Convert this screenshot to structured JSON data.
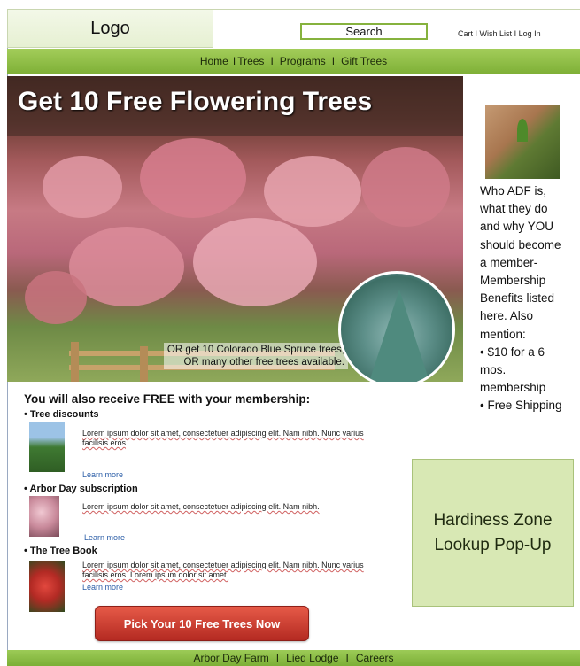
{
  "header": {
    "logo": "Logo",
    "search_label": "Search",
    "top_links": [
      "Cart",
      "Wish List",
      "Log In"
    ]
  },
  "nav": {
    "items": [
      "Home",
      "Trees",
      "Programs",
      "Gift Trees"
    ]
  },
  "hero": {
    "title": "Get 10 Free Flowering Trees",
    "caption_line1": "OR get 10 Colorado Blue Spruce trees,",
    "caption_line2": "OR many other free trees available."
  },
  "sidebar": {
    "lines": [
      "Who ADF is,",
      "what they do",
      "and why YOU",
      "should become",
      "a member-",
      "Membership",
      "Benefits listed",
      "here. Also",
      "mention:",
      "• $10 for a 6",
      "mos.",
      "membership",
      "• Free Shipping"
    ],
    "hardiness_line1": "Hardiness Zone",
    "hardiness_line2": "Lookup Pop-Up"
  },
  "membership": {
    "title": "You will also receive FREE with your membership:",
    "items": [
      {
        "title": "• Tree discounts",
        "text": "Lorem ipsum dolor sit amet, consectetuer adipiscing elit. Nam nibh. Nunc varius facilisis eros",
        "link": "Learn more"
      },
      {
        "title": "• Arbor Day subscription",
        "text": "Lorem ipsum dolor sit amet, consectetuer adipiscing elit. Nam nibh.",
        "link": "Learn more"
      },
      {
        "title": "• The Tree Book",
        "text": "Lorem ipsum dolor sit amet, consectetuer adipiscing elit. Nam nibh. Nunc varius facilisis eros. Lorem ipsum dolor sit amet.",
        "link": "Learn more"
      }
    ]
  },
  "cta": {
    "label": "Pick Your 10 Free Trees Now"
  },
  "footer": {
    "items": [
      "Arbor Day Farm",
      "Lied Lodge",
      "Careers"
    ]
  },
  "colors": {
    "nav_green": "#8dbf45",
    "cta_red": "#c8392c",
    "panel_green": "#d8e8b4",
    "link_blue": "#2d5fa8"
  },
  "icons": [
    "hands-planting-image",
    "tree-discount-image",
    "arbor-day-magazine-image",
    "tree-book-image",
    "blue-spruce-image"
  ]
}
